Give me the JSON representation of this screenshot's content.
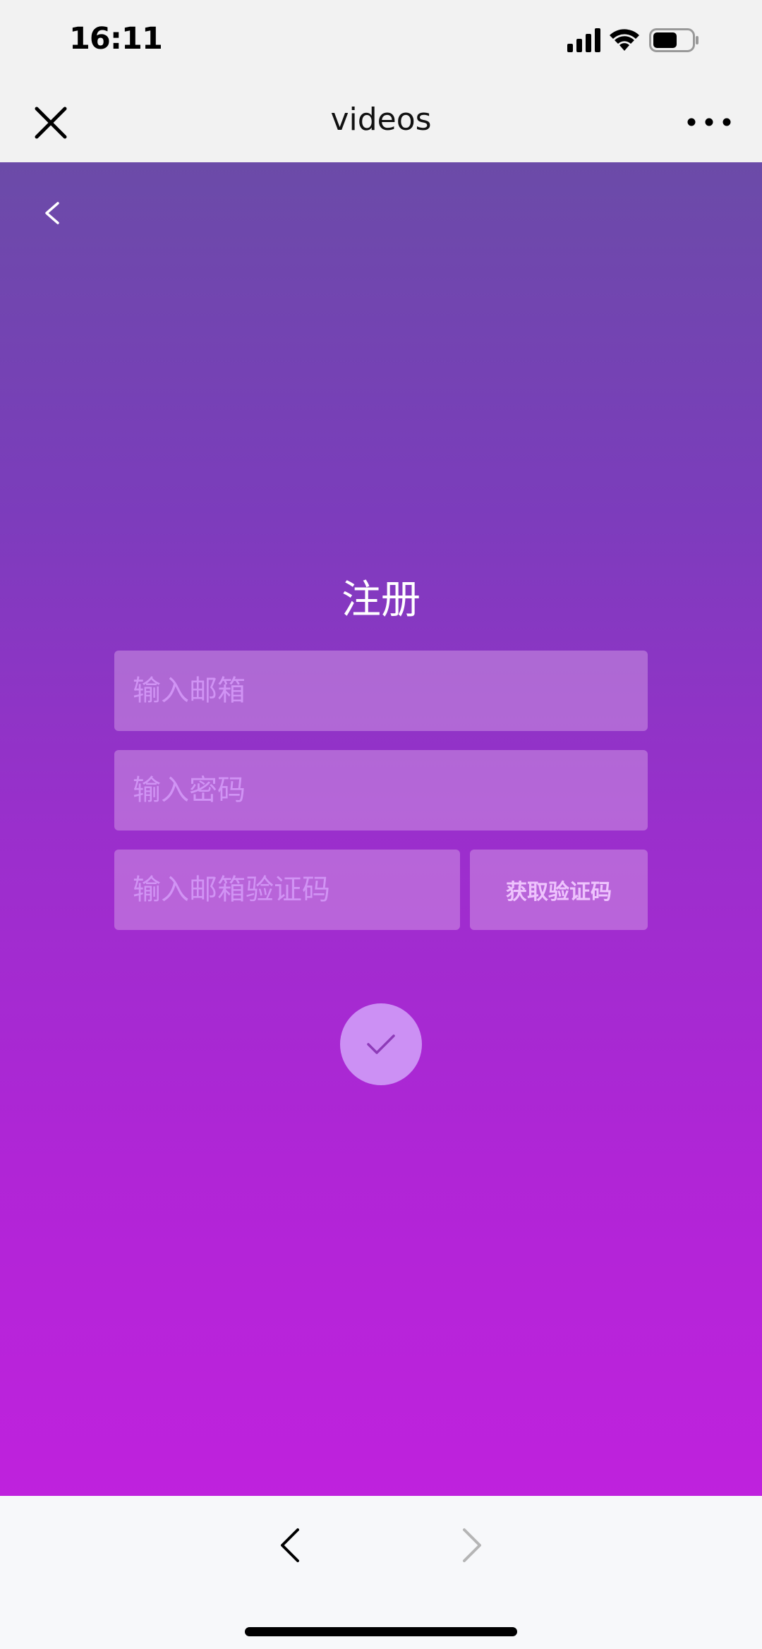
{
  "status_bar": {
    "time": "16:11",
    "icons": [
      "cellular-signal-icon",
      "wifi-icon",
      "battery-icon"
    ]
  },
  "nav_bar": {
    "title": "videos",
    "close_icon": "close-icon",
    "more_icon": "more-icon"
  },
  "form": {
    "title": "注册",
    "email_placeholder": "输入邮箱",
    "password_placeholder": "输入密码",
    "code_placeholder": "输入邮箱验证码",
    "get_code_label": "获取验证码",
    "submit_icon": "checkmark-icon"
  },
  "colors": {
    "gradient_top": "#6b4ba8",
    "gradient_bottom": "#bf22dd",
    "submit_button": "#cc90f4",
    "checkmark": "#8e3bb8"
  },
  "bottom_bar": {
    "back_icon": "chevron-left-icon",
    "forward_icon": "chevron-right-icon"
  }
}
